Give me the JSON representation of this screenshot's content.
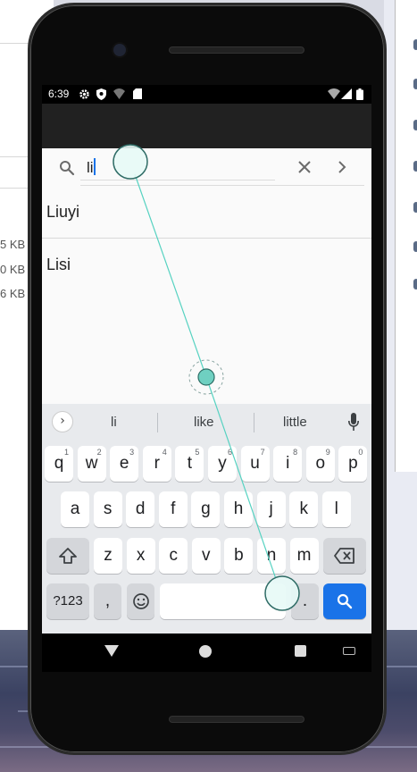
{
  "desktop": {
    "file_sizes": [
      "5 KB",
      "0 KB",
      "6 KB"
    ]
  },
  "status_bar": {
    "time": "6:39"
  },
  "search": {
    "query": "li",
    "icons": [
      "search-icon",
      "close-icon",
      "chevron-right-icon"
    ]
  },
  "results": [
    {
      "label": "Liuyi"
    },
    {
      "label": "Lisi"
    }
  ],
  "keyboard": {
    "suggestions": [
      "li",
      "like",
      "little"
    ],
    "row1": [
      {
        "key": "q",
        "hint": "1"
      },
      {
        "key": "w",
        "hint": "2"
      },
      {
        "key": "e",
        "hint": "3"
      },
      {
        "key": "r",
        "hint": "4"
      },
      {
        "key": "t",
        "hint": "5"
      },
      {
        "key": "y",
        "hint": "6"
      },
      {
        "key": "u",
        "hint": "7"
      },
      {
        "key": "i",
        "hint": "8"
      },
      {
        "key": "o",
        "hint": "9"
      },
      {
        "key": "p",
        "hint": "0"
      }
    ],
    "row2": [
      "a",
      "s",
      "d",
      "f",
      "g",
      "h",
      "j",
      "k",
      "l"
    ],
    "row3": [
      "z",
      "x",
      "c",
      "v",
      "b",
      "n",
      "m"
    ],
    "symbols_label": "?123",
    "comma_label": ",",
    "period_label": ".",
    "shift_icon": "shift-icon",
    "backspace_icon": "backspace-icon",
    "emoji_icon": "emoji-icon",
    "enter_icon": "search-icon"
  },
  "nav_bar": {
    "icons": [
      "back-icon",
      "home-icon",
      "recents-icon",
      "keyboard-switch-icon"
    ]
  },
  "colors": {
    "accent": "#1a73e8",
    "touch_marker": "#7fd8cc",
    "app_bar": "#212121",
    "keyboard_bg": "#e8eaed"
  },
  "gesture": {
    "type": "drag",
    "description_icons": [
      "touch-start-marker",
      "touch-path-midpoint",
      "touch-end-marker"
    ]
  }
}
